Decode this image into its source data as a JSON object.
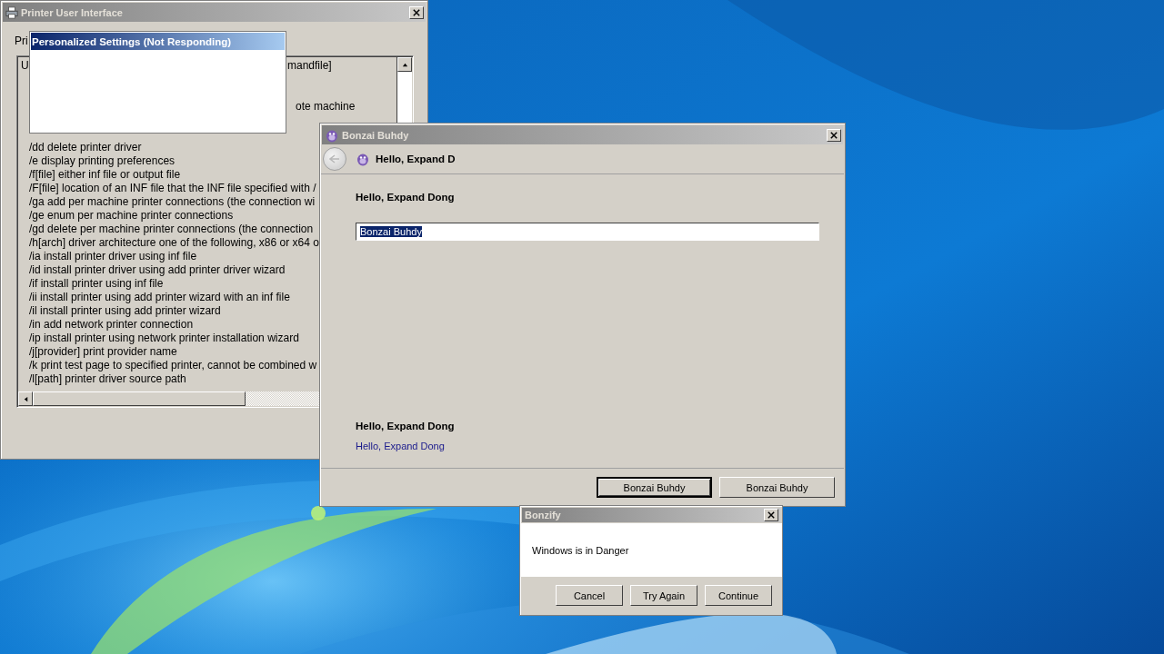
{
  "printer_window": {
    "title": "Printer User Interface",
    "label": "Pri",
    "usage_line": {
      "left": "U",
      "right": "mandfile]"
    },
    "fragment_line": {
      "right": "ote machine"
    },
    "option_lines": [
      {
        "left": "/dd delete printer driver"
      },
      {
        "left": "/e display printing preferences"
      },
      {
        "left": "/f[file] either inf file or output file"
      },
      {
        "left": "/F[file] location of an INF file that the INF file specified with /"
      },
      {
        "left": "/ga add per machine printer connections (the connection wi"
      },
      {
        "left": "/ge enum per machine printer connections"
      },
      {
        "left": "/gd delete per machine printer connections (the connection"
      },
      {
        "left": "/h[arch] driver architecture one of the following, x86 or x64 o"
      },
      {
        "left": "/ia install printer driver using inf file"
      },
      {
        "left": "/id install printer driver using add printer driver wizard"
      },
      {
        "left": "/if install printer using inf file"
      },
      {
        "left": "/ii install printer using add printer wizard with an inf file"
      },
      {
        "left": "/il install printer using add printer wizard"
      },
      {
        "left": "/in add network printer connection"
      },
      {
        "left": "/ip install printer using network printer installation wizard"
      },
      {
        "left": "/j[provider] print provider name"
      },
      {
        "left": "/k print test page to specified printer, cannot be combined w"
      },
      {
        "left": "/l[path] printer driver source path"
      }
    ]
  },
  "popup_window": {
    "title": "Personalized Settings (Not Responding)"
  },
  "bonzai_window": {
    "title": "Bonzai Buhdy",
    "header": "Hello, Expand D",
    "heading": "Hello, Expand Dong",
    "input": {
      "value": "Bonzai Buhdy",
      "selected": true
    },
    "footer_heading": "Hello, Expand Dong",
    "link": "Hello, Expand Dong",
    "buttons": [
      {
        "label": "Bonzai Buhdy",
        "default": true
      },
      {
        "label": "Bonzai Buhdy",
        "default": false
      }
    ]
  },
  "dialog": {
    "title": "Bonzify",
    "message": "Windows is in Danger",
    "buttons": [
      "Cancel",
      "Try Again",
      "Continue"
    ]
  }
}
